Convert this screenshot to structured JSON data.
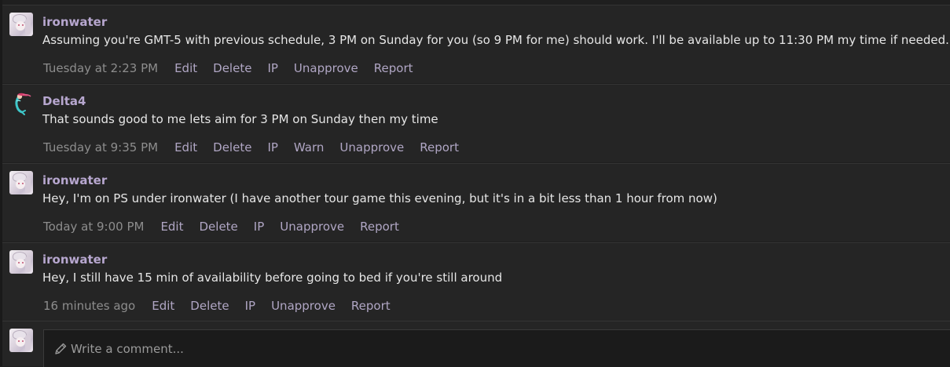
{
  "comments": [
    {
      "author": "ironwater",
      "avatar": "anime-avatar",
      "text": "Assuming you're GMT-5 with previous schedule, 3 PM on Sunday for you (so 9 PM for me) should work. I'll be available up to 11:30 PM my time if needed.",
      "time": "Tuesday at 2:23 PM",
      "actions": [
        "Edit",
        "Delete",
        "IP",
        "Unapprove",
        "Report"
      ]
    },
    {
      "author": "Delta4",
      "avatar": "mermaid-avatar",
      "text": "That sounds good to me lets aim for 3 PM on Sunday then my time",
      "time": "Tuesday at 9:35 PM",
      "actions": [
        "Edit",
        "Delete",
        "IP",
        "Warn",
        "Unapprove",
        "Report"
      ]
    },
    {
      "author": "ironwater",
      "avatar": "anime-avatar",
      "text": "Hey, I'm on PS under ironwater (I have another tour game this evening, but it's in a bit less than 1 hour from now)",
      "time": "Today at 9:00 PM",
      "actions": [
        "Edit",
        "Delete",
        "IP",
        "Unapprove",
        "Report"
      ]
    },
    {
      "author": "ironwater",
      "avatar": "anime-avatar",
      "text": "Hey, I still have 15 min of availability before going to bed if you're still around",
      "time": "16 minutes ago",
      "actions": [
        "Edit",
        "Delete",
        "IP",
        "Unapprove",
        "Report"
      ]
    }
  ],
  "composer": {
    "placeholder": "Write a comment...",
    "icon": "pencil-icon"
  },
  "colors": {
    "author": "#b7a7cf",
    "action_link": "#b0a6c4",
    "timestamp": "#8d8d8d",
    "body_text": "#e6e6e6",
    "background": "#252525"
  }
}
